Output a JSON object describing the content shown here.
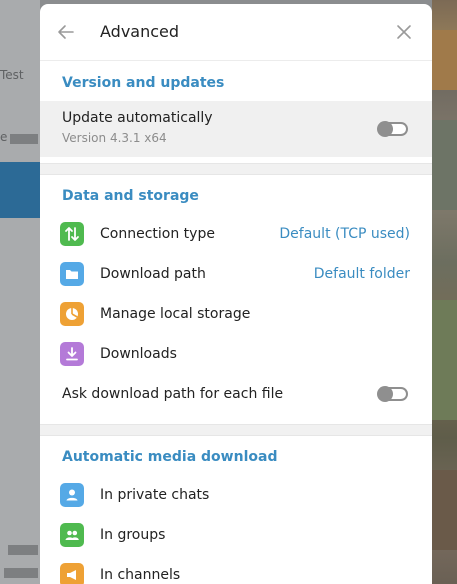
{
  "background": {
    "left_snippets": [
      "Test",
      "e"
    ],
    "accent": "#2c6a96"
  },
  "dialog": {
    "title": "Advanced",
    "back_icon": "arrow-left-icon",
    "close_icon": "close-icon"
  },
  "sections": {
    "version": {
      "title": "Version and updates",
      "update_label": "Update automatically",
      "version_text": "Version 4.3.1 x64",
      "update_enabled": false
    },
    "data": {
      "title": "Data and storage",
      "items": [
        {
          "label": "Connection type",
          "value": "Default (TCP used)",
          "icon": "arrows-up-down-icon",
          "color": "#4fba4f"
        },
        {
          "label": "Download path",
          "value": "Default folder",
          "icon": "folder-icon",
          "color": "#55a9e6"
        },
        {
          "label": "Manage local storage",
          "value": "",
          "icon": "pie-chart-icon",
          "color": "#eea135"
        },
        {
          "label": "Downloads",
          "value": "",
          "icon": "download-icon",
          "color": "#b47ad8"
        }
      ],
      "ask_path_label": "Ask download path for each file",
      "ask_path_enabled": false
    },
    "media": {
      "title": "Automatic media download",
      "items": [
        {
          "label": "In private chats",
          "icon": "person-icon",
          "color": "#55a9e6"
        },
        {
          "label": "In groups",
          "icon": "group-icon",
          "color": "#4fba4f"
        },
        {
          "label": "In channels",
          "icon": "megaphone-icon",
          "color": "#eea135"
        }
      ]
    }
  },
  "colors": {
    "accent": "#3a8cc1",
    "toggle_off": "#8f8f8f"
  }
}
